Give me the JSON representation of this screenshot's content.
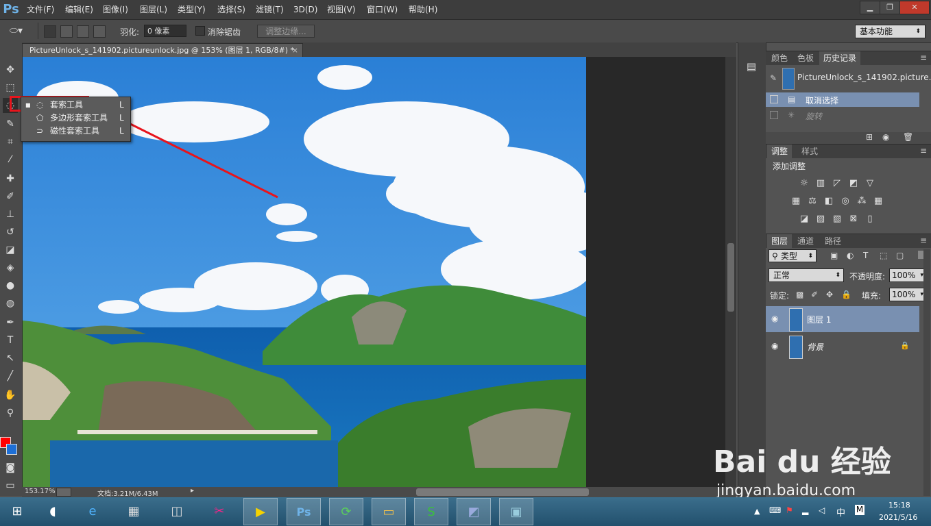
{
  "app": {
    "logo": "Ps"
  },
  "menu": [
    "文件(F)",
    "编辑(E)",
    "图像(I)",
    "图层(L)",
    "类型(Y)",
    "选择(S)",
    "滤镜(T)",
    "3D(D)",
    "视图(V)",
    "窗口(W)",
    "帮助(H)"
  ],
  "window_controls": {
    "minimize": "▁",
    "restore": "❐",
    "close": "✕"
  },
  "options": {
    "feather_label": "羽化:",
    "feather_value": "0 像素",
    "antialias_label": "消除锯齿",
    "refine_button": "调整边缘...",
    "workspace": "基本功能"
  },
  "document": {
    "tab_title": "PictureUnlock_s_141902.pictureunlock.jpg @ 153% (图层 1, RGB/8#) *",
    "zoom": "153.17%",
    "doc_size": "文档:3.21M/6.43M"
  },
  "flyout": {
    "items": [
      {
        "label": "套索工具",
        "shortcut": "L",
        "selected": true
      },
      {
        "label": "多边形套索工具",
        "shortcut": "L",
        "selected": false
      },
      {
        "label": "磁性套索工具",
        "shortcut": "L",
        "selected": false
      }
    ]
  },
  "history_panel": {
    "tabs": [
      "颜色",
      "色板",
      "历史记录"
    ],
    "snapshot": "PictureUnlock_s_141902.picture...",
    "items": [
      "取消选择",
      "旋转"
    ]
  },
  "adjustments_panel": {
    "tabs": [
      "调整",
      "样式"
    ],
    "title": "添加调整"
  },
  "layers_panel": {
    "tabs": [
      "图层",
      "通道",
      "路径"
    ],
    "filter": "类型",
    "blend_mode": "正常",
    "opacity_label": "不透明度:",
    "opacity": "100%",
    "lock_label": "锁定:",
    "fill_label": "填充:",
    "fill": "100%",
    "layers": [
      {
        "name": "图层 1",
        "selected": true
      },
      {
        "name": "背景",
        "selected": false
      }
    ]
  },
  "watermark": {
    "brand": "Bai du 经验",
    "url": "jingyan.baidu.com"
  },
  "taskbar": {
    "time": "15:18",
    "date": "2021/5/16",
    "ime": "中",
    "ime2": "M"
  },
  "colors": {
    "foreground": "#ff0000",
    "background": "#1e6fd6",
    "highlight_box": "#e8141c"
  }
}
